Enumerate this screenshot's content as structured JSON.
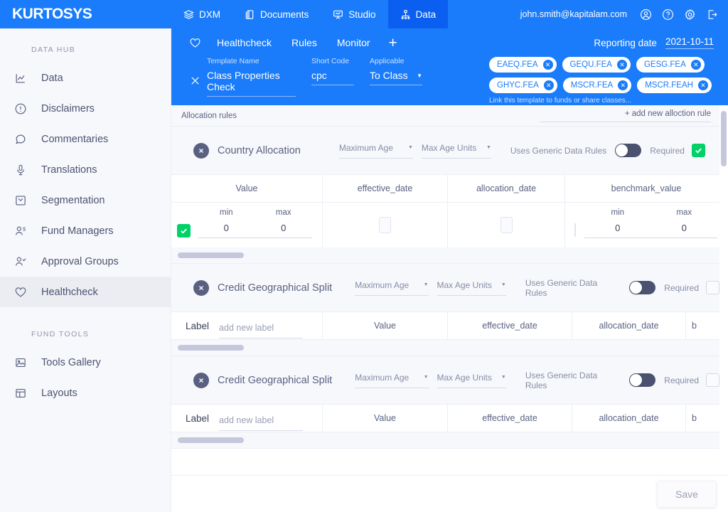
{
  "topbar": {
    "brand": "KURTOSYS",
    "nav": [
      {
        "label": "DXM",
        "icon": "layers-icon",
        "active": false
      },
      {
        "label": "Documents",
        "icon": "documents-icon",
        "active": false
      },
      {
        "label": "Studio",
        "icon": "studio-icon",
        "active": false
      },
      {
        "label": "Data",
        "icon": "data-hierarchy-icon",
        "active": true
      }
    ],
    "user_email": "john.smith@kapitalam.com",
    "icons": [
      "account-icon",
      "help-icon",
      "settings-icon",
      "logout-icon"
    ],
    "bg_color": "#1a7cfb",
    "active_tab_color": "#0b5ff0"
  },
  "sidebar": {
    "sections": [
      {
        "title": "DATA HUB",
        "items": [
          {
            "label": "Data",
            "icon": "chart-line-icon",
            "active": false
          },
          {
            "label": "Disclaimers",
            "icon": "info-circle-icon",
            "active": false
          },
          {
            "label": "Commentaries",
            "icon": "comment-icon",
            "active": false
          },
          {
            "label": "Translations",
            "icon": "microphone-icon",
            "active": false
          },
          {
            "label": "Segmentation",
            "icon": "box-icon",
            "active": false
          },
          {
            "label": "Fund Managers",
            "icon": "user-dollar-icon",
            "active": false
          },
          {
            "label": "Approval Groups",
            "icon": "user-check-icon",
            "active": false
          },
          {
            "label": "Healthcheck",
            "icon": "heart-icon",
            "active": true
          }
        ]
      },
      {
        "title": "FUND TOOLS",
        "items": [
          {
            "label": "Tools Gallery",
            "icon": "image-icon",
            "active": false
          },
          {
            "label": "Layouts",
            "icon": "layout-icon",
            "active": false
          }
        ]
      }
    ]
  },
  "template_header": {
    "favorite_icon": "heart-icon",
    "tabs": [
      {
        "label": "Healthcheck"
      },
      {
        "label": "Rules"
      },
      {
        "label": "Monitor"
      }
    ],
    "add_tab_label": "+",
    "close_icon": "close-icon",
    "fields": [
      {
        "label": "Template Name",
        "value": "Class Properties Check",
        "type": "text"
      },
      {
        "label": "Short Code",
        "value": "cpc",
        "type": "text"
      },
      {
        "label": "Applicable",
        "value": "To Class",
        "type": "select"
      }
    ],
    "reporting_date_label": "Reporting date",
    "reporting_date_value": "2021-10-11",
    "chips": [
      {
        "label": "EAEQ.FEA"
      },
      {
        "label": "GEQU.FEA"
      },
      {
        "label": "GESG.FEA"
      },
      {
        "label": "GHYC.FEA"
      },
      {
        "label": "MSCR.FEA"
      },
      {
        "label": "MSCR.FEAH"
      }
    ],
    "link_hint": "Link this template to funds or share classes..."
  },
  "allocation_bar": {
    "title": "Allocation rules",
    "add_rule_label": "+ add new alloction rule"
  },
  "rules": [
    {
      "name": "Country Allocation",
      "max_age_label": "Maximum Age",
      "max_age_units_label": "Max Age Units",
      "generic_rules_label": "Uses Generic Data Rules",
      "generic_rules_on": false,
      "required_label": "Required",
      "required_checked": true,
      "table_type": "minmax",
      "columns": [
        "Value",
        "effective_date",
        "allocation_date",
        "benchmark_value"
      ],
      "row": {
        "value_checked": true,
        "value_min_label": "min",
        "value_max_label": "max",
        "value_min": "0",
        "value_max": "0",
        "effective_date_checked": false,
        "allocation_date_checked": false,
        "benchmark_checked": false,
        "benchmark_min_label": "min",
        "benchmark_max_label": "max",
        "benchmark_min": "0",
        "benchmark_max": "0"
      }
    },
    {
      "name": "Credit Geographical Split",
      "max_age_label": "Maximum Age",
      "max_age_units_label": "Max Age Units",
      "generic_rules_label": "Uses Generic Data Rules",
      "generic_rules_on": false,
      "required_label": "Required",
      "required_checked": false,
      "table_type": "label",
      "columns": [
        "Value",
        "effective_date",
        "allocation_date",
        "b"
      ],
      "row": {
        "label_title": "Label",
        "label_placeholder": "add new label"
      }
    },
    {
      "name": "Credit Geographical Split",
      "max_age_label": "Maximum Age",
      "max_age_units_label": "Max Age Units",
      "generic_rules_label": "Uses Generic Data Rules",
      "generic_rules_on": false,
      "required_label": "Required",
      "required_checked": false,
      "table_type": "label",
      "columns": [
        "Value",
        "effective_date",
        "allocation_date",
        "b"
      ],
      "row": {
        "label_title": "Label",
        "label_placeholder": "add new label"
      }
    }
  ],
  "footer": {
    "save_label": "Save"
  },
  "colors": {
    "brand_blue": "#1a7cfb",
    "active_blue": "#0b5ff0",
    "green_check": "#00d268",
    "slate": "#5a6180",
    "toggle_track": "#4a5270",
    "scrollbar": "#c5c8dc"
  }
}
